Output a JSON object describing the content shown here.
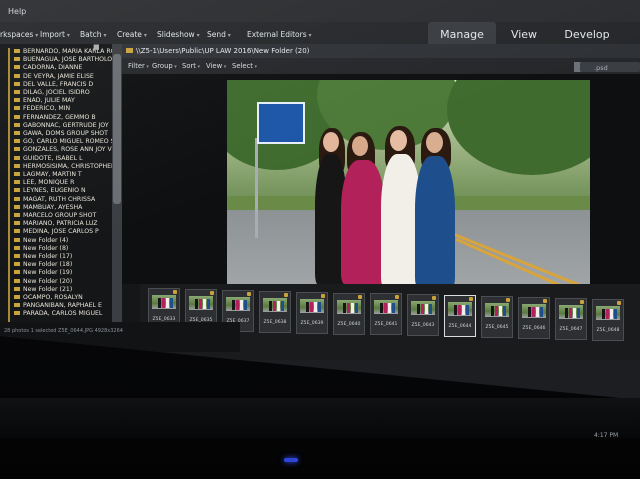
{
  "menu": {
    "help": "Help"
  },
  "toolbar": {
    "workspaces": "rkspaces",
    "import": "Import",
    "batch": "Batch",
    "create": "Create",
    "slideshow": "Slideshow",
    "send": "Send",
    "external_editors": "External Editors"
  },
  "modes": {
    "manage": "Manage",
    "view": "View",
    "develop": "Develop"
  },
  "path": "\\\\Z5-1\\Users\\Public\\UP LAW 2016\\New Folder (20)",
  "filter_bar": {
    "filter": "Filter",
    "group": "Group",
    "sort": "Sort",
    "view": "View",
    "select": "Select"
  },
  "search": {
    "extension": ".psd"
  },
  "folders": [
    "BERNARDO, MARIA KARLA ROSITA",
    "BUENAGUA, JOSE BARTHOLOMEW",
    "CADORNA, DIANNE",
    "DE VEYRA, JAMIE ELISE",
    "DEL VALLE, FRANCIS D",
    "DILAG, JOCIEL ISIDRO",
    "ENAD, JULIE MAY",
    "FEDERICO, MIN",
    "FERNANDEZ, GEMMO B",
    "GABONNAC, GERTRUDE JOY",
    "GAWA, DOMS GROUP SHOT",
    "GO, CARLO MIGUEL ROMEO S",
    "GONZALES, ROSE ANN JOY V",
    "GUIDOTE, ISABEL L",
    "HERMOSISIMA, CHRISTOPHER AN",
    "LAGMAY, MARTIN T",
    "LEE, MONIQUE R",
    "LEYNES, EUGENIO N",
    "MAGAT, RUTH CHRISSA",
    "MAMBUAY, AYESHA",
    "MARCELO GROUP SHOT",
    "MARIANO, PATRICIA LUZ",
    "MEDINA, JOSE CARLOS P",
    "New Folder (4)",
    "New Folder (8)",
    "New Folder (17)",
    "New Folder (18)",
    "New Folder (19)",
    "New Folder (20)",
    "New Folder (21)",
    "OCAMPO, ROSALYN",
    "PANGANIBAN, RAPHAEL E",
    "PARADA, CARLOS MIGUEL"
  ],
  "thumbnails": [
    "Z5E_0633",
    "Z5E_0635",
    "Z5E_0637",
    "Z5E_0638",
    "Z5E_0639",
    "Z5E_0640",
    "Z5E_0641",
    "Z5E_0643",
    "Z5E_0644",
    "Z5E_0645",
    "Z5E_0646",
    "Z5E_0647",
    "Z5E_0648"
  ],
  "status": {
    "text": "28 photos  1 selected  Z5E_0644.JPG  4928x3264"
  },
  "tray": {
    "time": "4:17 PM"
  },
  "colors": {
    "accent_blue": "#3aa7c9",
    "folder_gold": "#c9a23a",
    "panel_dark": "#1c1e21"
  }
}
